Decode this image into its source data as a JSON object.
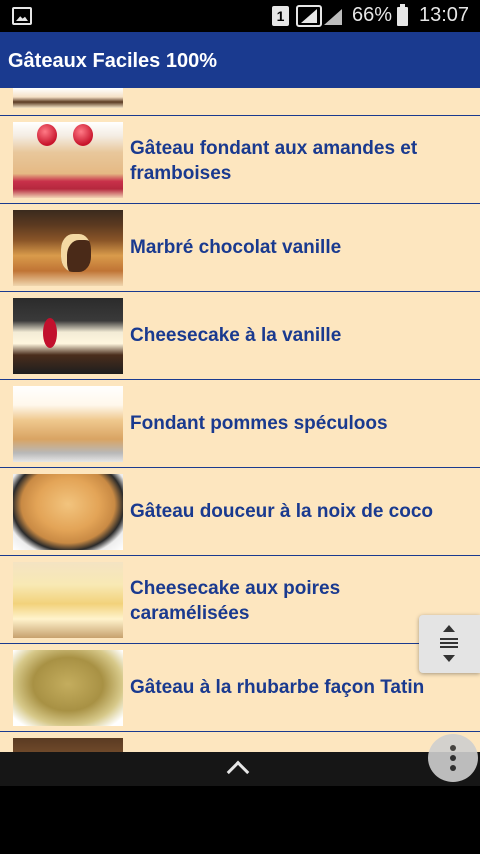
{
  "status_bar": {
    "sim_slot": "1",
    "battery_percent": "66%",
    "time": "13:07"
  },
  "app_bar": {
    "title": "Gâteaux Faciles 100%"
  },
  "recipes": [
    {
      "label": "Gâteau fondant aux amandes et framboises",
      "thumbnail": "almond-raspberry-cake"
    },
    {
      "label": "Marbré chocolat vanille",
      "thumbnail": "marble-cake"
    },
    {
      "label": "Cheesecake à la vanille",
      "thumbnail": "vanilla-cheesecake"
    },
    {
      "label": "Fondant pommes spéculoos",
      "thumbnail": "apple-speculoos-cake"
    },
    {
      "label": "Gâteau douceur à la noix de coco",
      "thumbnail": "coconut-cake"
    },
    {
      "label": "Cheesecake aux poires caramélisées",
      "thumbnail": "pear-cheesecake"
    },
    {
      "label": "Gâteau à la rhubarbe façon Tatin",
      "thumbnail": "rhubarb-tatin"
    }
  ],
  "icons": {
    "status": [
      "gallery-icon",
      "sim-icon",
      "signal-icon",
      "battery-icon"
    ],
    "scroll": [
      "scroll-up-icon",
      "scroll-handle-icon",
      "scroll-down-icon"
    ],
    "nav": [
      "chevron-up-icon",
      "overflow-menu-icon"
    ]
  },
  "colors": {
    "app_bar": "#1a3a8f",
    "list_background": "#fde6bf",
    "label_text": "#1a3a8f"
  }
}
